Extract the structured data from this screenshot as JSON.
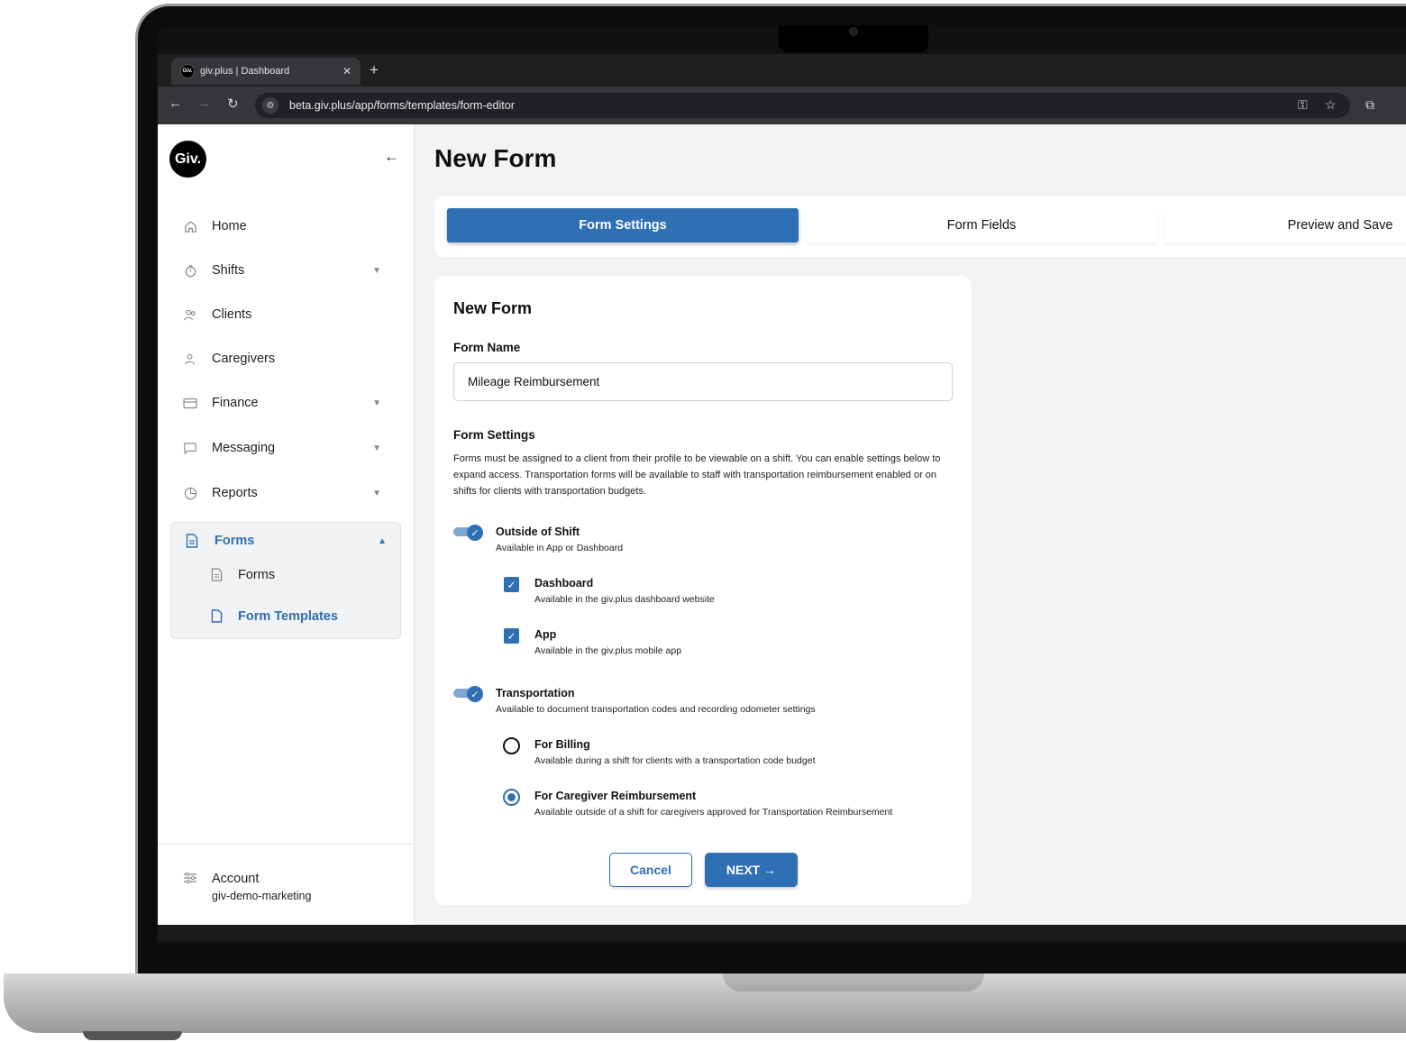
{
  "browser": {
    "tab_title": "giv.plus | Dashboard",
    "favicon_text": "Giv.",
    "url": "beta.giv.plus/app/forms/templates/form-editor"
  },
  "sidebar": {
    "logo": "Giv.",
    "items": [
      {
        "label": "Home",
        "icon": "home-icon"
      },
      {
        "label": "Shifts",
        "icon": "stopwatch-icon"
      },
      {
        "label": "Clients",
        "icon": "users-icon"
      },
      {
        "label": "Caregivers",
        "icon": "caregiver-icon"
      },
      {
        "label": "Finance",
        "icon": "card-icon"
      },
      {
        "label": "Messaging",
        "icon": "message-icon"
      },
      {
        "label": "Reports",
        "icon": "pie-chart-icon"
      }
    ],
    "forms_group": {
      "label": "Forms",
      "children": [
        {
          "label": "Forms"
        },
        {
          "label": "Form Templates"
        }
      ]
    },
    "account": {
      "label": "Account",
      "name": "giv-demo-marketing"
    }
  },
  "main": {
    "title": "New Form",
    "steps": [
      "Form Settings",
      "Form Fields",
      "Preview and Save"
    ],
    "card": {
      "title": "New Form",
      "form_name_label": "Form Name",
      "form_name_value": "Mileage Reimbursement",
      "settings_label": "Form Settings",
      "settings_desc": "Forms must be assigned to a client from their profile to be viewable on a shift. You can enable settings below to expand access. Transportation forms will be available to staff with transportation reimbursement enabled or on shifts for clients with transportation budgets.",
      "outside_shift": {
        "title": "Outside of Shift",
        "desc": "Available in App or Dashboard",
        "enabled": true
      },
      "dashboard": {
        "title": "Dashboard",
        "desc": "Available in the giv.plus dashboard website",
        "checked": true
      },
      "app": {
        "title": "App",
        "desc": "Available in the giv.plus mobile app",
        "checked": true
      },
      "transportation": {
        "title": "Transportation",
        "desc": "Available to document transportation codes and recording odometer settings",
        "enabled": true
      },
      "billing": {
        "title": "For Billing",
        "desc": "Available during a shift for clients with a transportation code budget",
        "selected": false
      },
      "reimbursement": {
        "title": "For Caregiver Reimbursement",
        "desc": "Available outside of a shift for caregivers approved for Transportation Reimbursement",
        "selected": true
      },
      "cancel_label": "Cancel",
      "next_label": "NEXT →"
    }
  },
  "colors": {
    "accent": "#2f6fb3",
    "background": "#f2f3f3"
  }
}
